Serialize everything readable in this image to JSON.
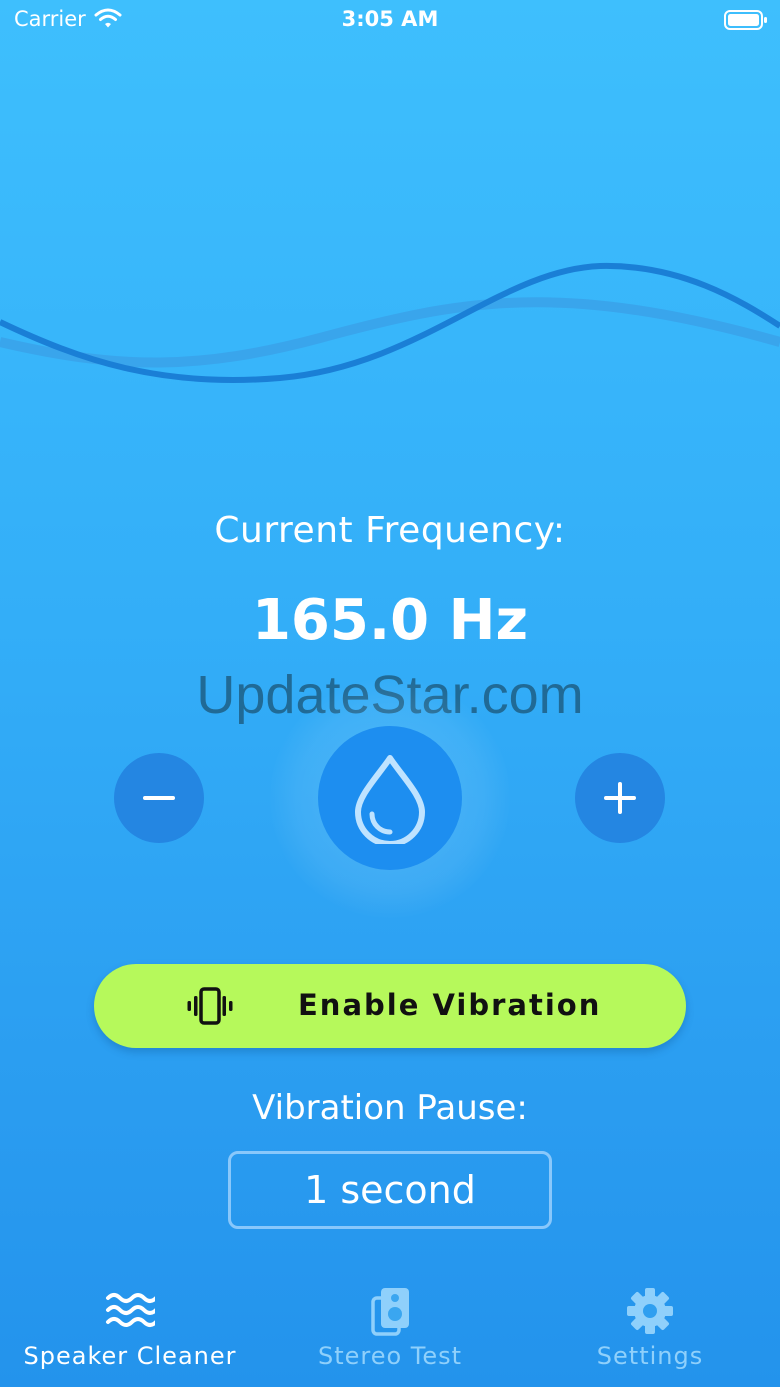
{
  "status_bar": {
    "carrier": "Carrier",
    "time": "3:05 AM"
  },
  "frequency": {
    "label": "Current Frequency:",
    "value": "165.0 Hz"
  },
  "watermark": "UpdateStar.com",
  "controls": {
    "decrease_icon": "minus-icon",
    "increase_icon": "plus-icon",
    "main_icon": "water-drop-icon"
  },
  "vibration": {
    "button_label": "Enable Vibration",
    "icon": "vibration-icon",
    "pause_label": "Vibration Pause:",
    "pause_value": "1 second"
  },
  "tabs": [
    {
      "label": "Speaker Cleaner",
      "icon": "waves-icon",
      "active": true
    },
    {
      "label": "Stereo Test",
      "icon": "speaker-icon",
      "active": false
    },
    {
      "label": "Settings",
      "icon": "gear-icon",
      "active": false
    }
  ],
  "colors": {
    "background_top": "#3ebffd",
    "background_bottom": "#2393ec",
    "accent_green": "#b6f95b",
    "wave_dark": "#1a7fd6",
    "wave_light": "#3aa3ea"
  }
}
